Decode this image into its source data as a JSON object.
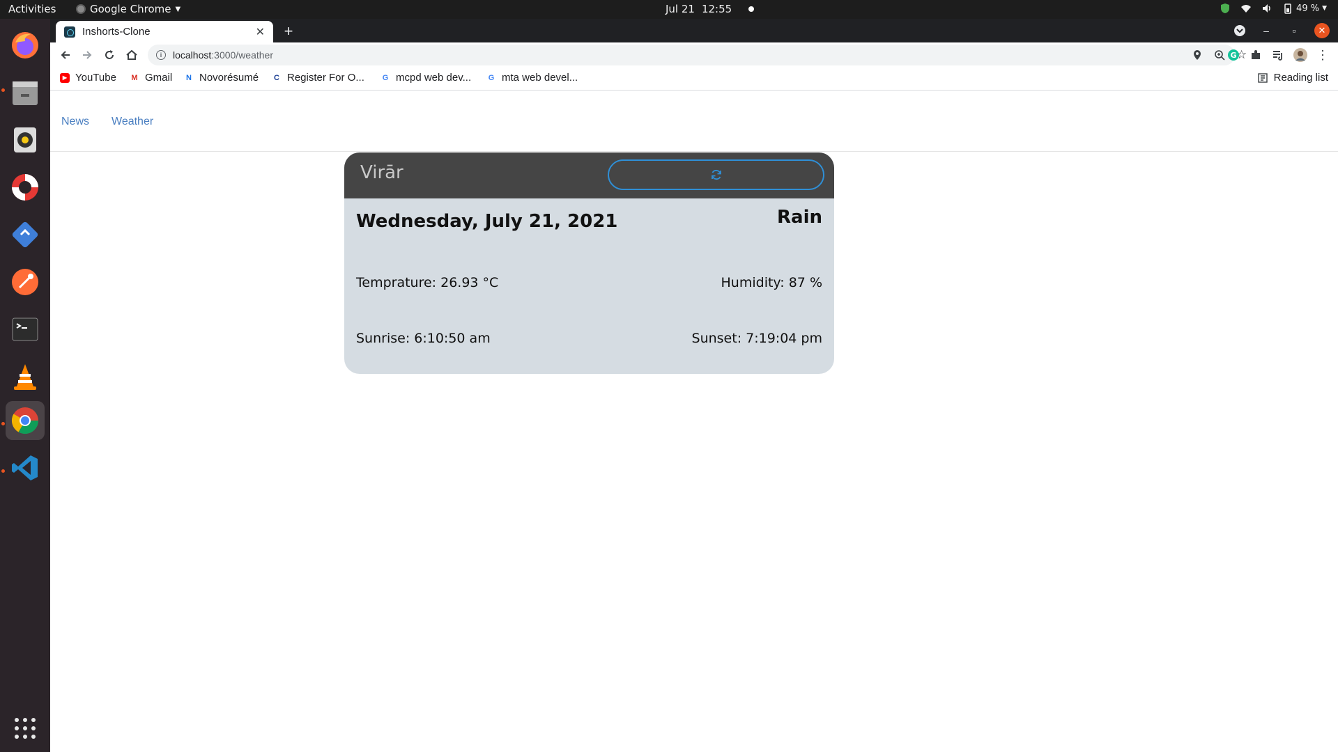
{
  "system": {
    "activities": "Activities",
    "app_menu": "Google Chrome",
    "date": "Jul 21",
    "time": "12:55",
    "battery": "49 %"
  },
  "browser": {
    "tab_title": "Inshorts-Clone",
    "url_host": "localhost",
    "url_path": ":3000/weather",
    "bookmarks": [
      {
        "label": "YouTube",
        "icon": "youtube-icon",
        "color": "#ff0000"
      },
      {
        "label": "Gmail",
        "icon": "gmail-icon",
        "color": "#d93025"
      },
      {
        "label": "Novorésumé",
        "icon": "novoresume-icon",
        "color": "#1a73e8"
      },
      {
        "label": "Register For O...",
        "icon": "coursera-icon",
        "color": "#1c3f94"
      },
      {
        "label": "mcpd web dev...",
        "icon": "google-icon",
        "color": "#4285f4"
      },
      {
        "label": "mta web devel...",
        "icon": "google-icon",
        "color": "#4285f4"
      }
    ],
    "reading_list": "Reading list"
  },
  "app": {
    "nav": {
      "news": "News",
      "weather": "Weather"
    },
    "weather": {
      "city": "Virār",
      "date": "Wednesday, July 21, 2021",
      "condition": "Rain",
      "temperature": "Temprature: 26.93 °C",
      "humidity": "Humidity: 87 %",
      "sunrise": "Sunrise: 6:10:50 am",
      "sunset": "Sunset: 7:19:04 pm",
      "refresh_icon": "refresh-icon"
    }
  },
  "colors": {
    "link": "#4a7fc1",
    "card_header": "#454545",
    "card_body": "#d5dce2",
    "accent": "#2f8fd6",
    "ubuntu_orange": "#e95420"
  }
}
